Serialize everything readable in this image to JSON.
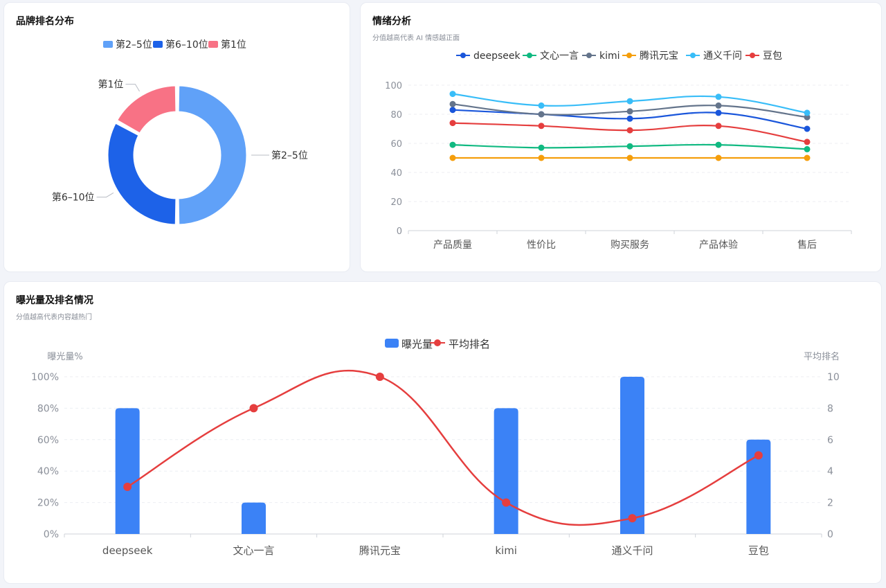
{
  "brand_card": {
    "title": "品牌排名分布",
    "chart_data": {
      "type": "pie",
      "categories": [
        "第2–5位",
        "第6–10位",
        "第1位"
      ],
      "values": [
        50,
        33,
        17
      ],
      "colors": [
        "#60a1f8",
        "#1d62e8",
        "#f87285"
      ],
      "legend_placement": "top"
    }
  },
  "sentiment_card": {
    "title": "情绪分析",
    "subtitle": "分值越高代表 AI 情感越正面",
    "chart_data": {
      "type": "line",
      "categories": [
        "产品质量",
        "性价比",
        "购买服务",
        "产品体验",
        "售后"
      ],
      "ylim": [
        0,
        100
      ],
      "yticks": [
        0,
        20,
        40,
        60,
        80,
        100
      ],
      "grid": true,
      "legend_placement": "top",
      "series": [
        {
          "name": "deepseek",
          "color": "#1a56db",
          "values": [
            83,
            80,
            77,
            81,
            70
          ]
        },
        {
          "name": "文心一言",
          "color": "#10b981",
          "values": [
            59,
            57,
            58,
            59,
            56
          ]
        },
        {
          "name": "kimi",
          "color": "#64748b",
          "values": [
            87,
            80,
            82,
            86,
            78
          ]
        },
        {
          "name": "腾讯元宝",
          "color": "#f59e0b",
          "values": [
            50,
            50,
            50,
            50,
            50
          ]
        },
        {
          "name": "通义千问",
          "color": "#38bdf8",
          "values": [
            94,
            86,
            89,
            92,
            81
          ]
        },
        {
          "name": "豆包",
          "color": "#e53e3e",
          "values": [
            74,
            72,
            69,
            72,
            61
          ]
        }
      ]
    }
  },
  "exposure_card": {
    "title": "曝光量及排名情况",
    "subtitle": "分值越高代表内容越热门",
    "chart_data": {
      "type": "bar",
      "categories": [
        "deepseek",
        "文心一言",
        "腾讯元宝",
        "kimi",
        "通义千问",
        "豆包"
      ],
      "ylabel": "曝光量%",
      "y2label": "平均排名",
      "ylim": [
        0,
        100
      ],
      "yticks": [
        "0%",
        "20%",
        "40%",
        "60%",
        "80%",
        "100%"
      ],
      "y2lim": [
        0,
        10
      ],
      "y2ticks": [
        0,
        2,
        4,
        6,
        8,
        10
      ],
      "grid": true,
      "legend_placement": "top",
      "series": [
        {
          "name": "曝光量",
          "kind": "bar",
          "axis": "left",
          "color": "#3b82f6",
          "values": [
            80,
            20,
            0,
            80,
            100,
            60
          ]
        },
        {
          "name": "平均排名",
          "kind": "line",
          "axis": "right",
          "color": "#e53e3e",
          "values": [
            3,
            8,
            10,
            2,
            1,
            5
          ]
        }
      ]
    }
  }
}
